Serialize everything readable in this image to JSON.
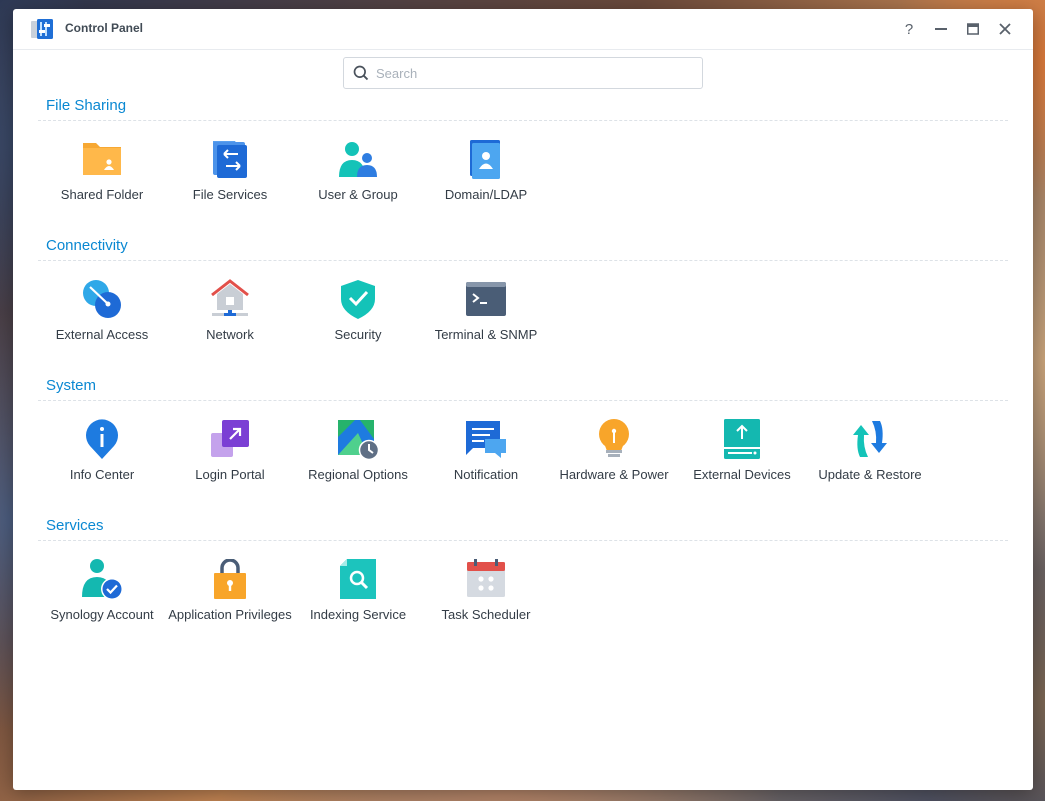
{
  "window": {
    "title": "Control Panel",
    "controls": {
      "help": "?"
    }
  },
  "search": {
    "placeholder": "Search",
    "value": ""
  },
  "sections": [
    {
      "title": "File Sharing",
      "items": [
        {
          "label": "Shared Folder",
          "icon": "folder-icon"
        },
        {
          "label": "File Services",
          "icon": "file-services-icon"
        },
        {
          "label": "User & Group",
          "icon": "user-group-icon"
        },
        {
          "label": "Domain/LDAP",
          "icon": "domain-ldap-icon"
        }
      ]
    },
    {
      "title": "Connectivity",
      "items": [
        {
          "label": "External Access",
          "icon": "external-access-icon"
        },
        {
          "label": "Network",
          "icon": "network-icon"
        },
        {
          "label": "Security",
          "icon": "shield-icon"
        },
        {
          "label": "Terminal & SNMP",
          "icon": "terminal-icon"
        }
      ]
    },
    {
      "title": "System",
      "items": [
        {
          "label": "Info Center",
          "icon": "info-icon"
        },
        {
          "label": "Login Portal",
          "icon": "login-portal-icon"
        },
        {
          "label": "Regional Options",
          "icon": "regional-options-icon"
        },
        {
          "label": "Notification",
          "icon": "notification-icon"
        },
        {
          "label": "Hardware & Power",
          "icon": "lightbulb-icon"
        },
        {
          "label": "External Devices",
          "icon": "external-devices-icon"
        },
        {
          "label": "Update & Restore",
          "icon": "update-restore-icon"
        }
      ]
    },
    {
      "title": "Services",
      "items": [
        {
          "label": "Synology Account",
          "icon": "synology-account-icon"
        },
        {
          "label": "Application Privileges",
          "icon": "lock-icon"
        },
        {
          "label": "Indexing Service",
          "icon": "indexing-icon"
        },
        {
          "label": "Task Scheduler",
          "icon": "calendar-icon"
        }
      ]
    }
  ]
}
